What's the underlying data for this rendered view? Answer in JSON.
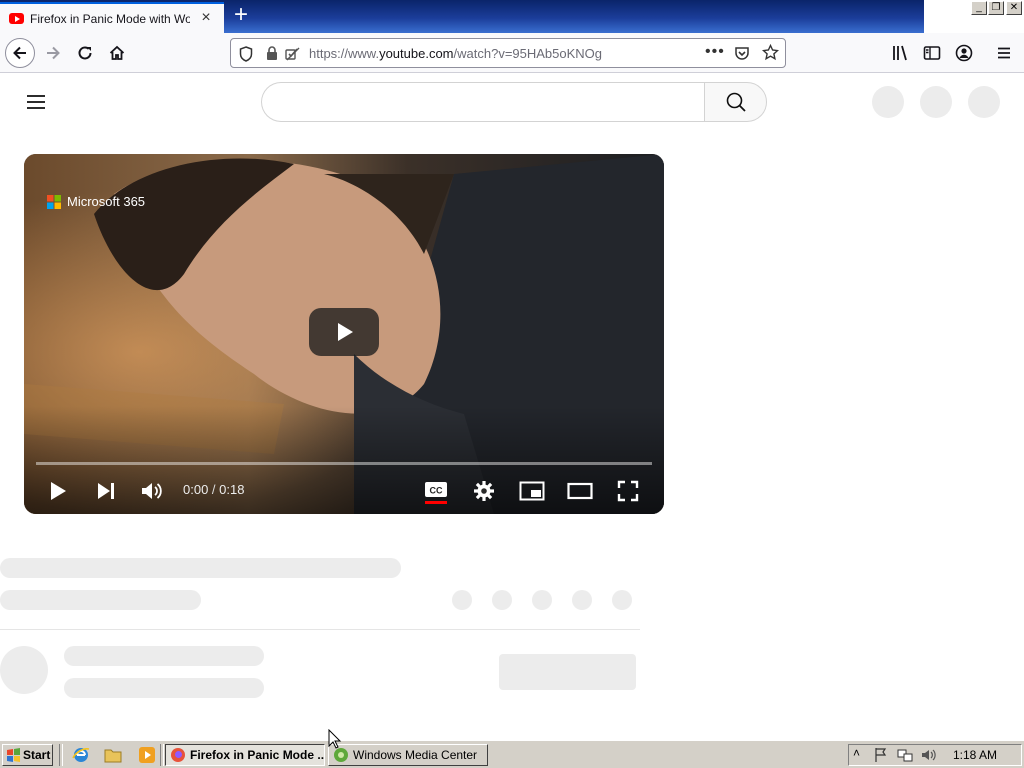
{
  "browser": {
    "tab_title": "Firefox in Panic Mode with Worst C",
    "url_scheme": "https://www.",
    "url_host": "youtube.com",
    "url_path": "/watch?v=95HAb5oKNOg"
  },
  "video": {
    "brand_text": "Microsoft 365",
    "time_current": "0:00",
    "time_separator": " / ",
    "time_total": "0:18",
    "progress_fraction": 0
  },
  "taskbar": {
    "start_label": "Start",
    "firefox_item": "Firefox in Panic Mode ...",
    "wmc_item": "Windows Media Center",
    "clock": "1:18 AM"
  },
  "colors": {
    "accent": "#0060df",
    "youtube_red": "#ff0000",
    "taskbar": "#d4d0c8",
    "skeleton": "#ececec"
  },
  "icons": [
    "back-arrow-icon",
    "forward-arrow-icon",
    "reload-icon",
    "home-icon",
    "shield-icon",
    "lock-icon",
    "permissions-icon",
    "more-dots-icon",
    "pocket-icon",
    "star-icon",
    "library-icon",
    "sidebar-icon",
    "account-icon",
    "menu-icon",
    "hamburger-icon",
    "search-icon",
    "play-icon",
    "next-icon",
    "volume-icon",
    "cc-icon",
    "settings-gear-icon",
    "miniplayer-icon",
    "theater-icon",
    "fullscreen-icon",
    "windows-flag-icon",
    "ie-icon",
    "folder-icon",
    "media-player-icon"
  ]
}
